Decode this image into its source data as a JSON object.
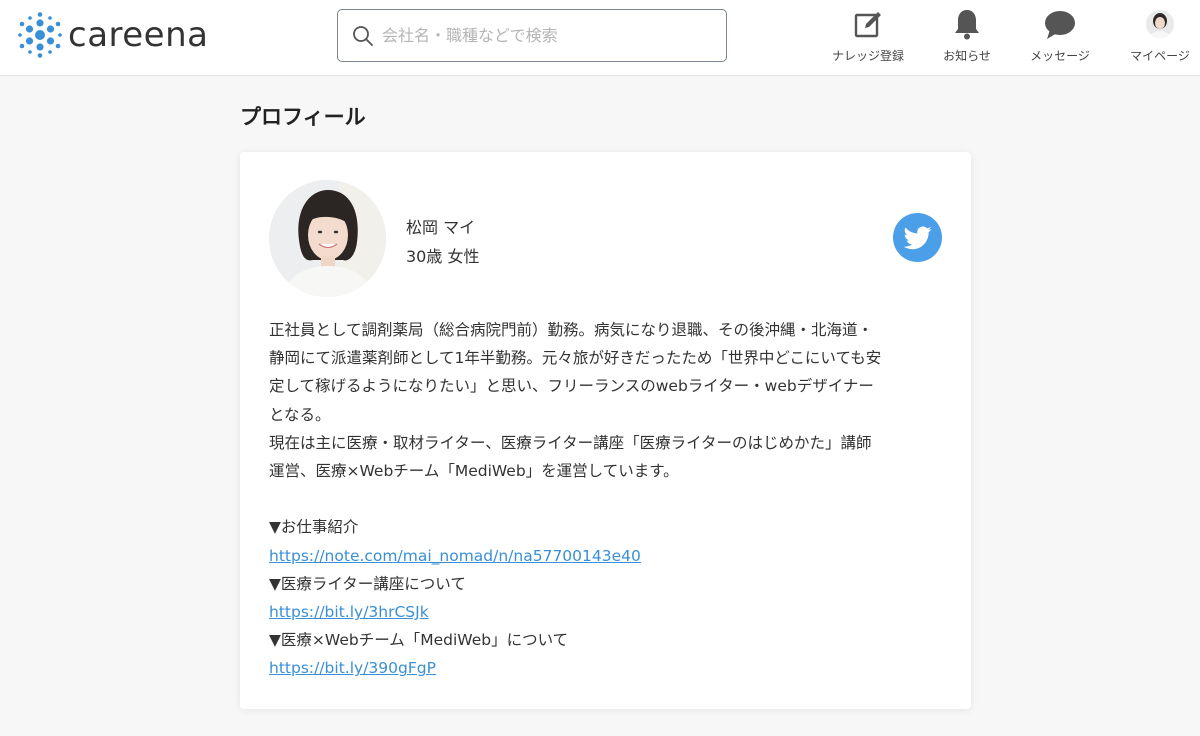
{
  "brand": {
    "name": "careena",
    "color": "#3a8fd6"
  },
  "search": {
    "placeholder": "会社名・職種などで検索",
    "value": ""
  },
  "nav": [
    {
      "label": "ナレッジ登録",
      "icon": "edit-icon"
    },
    {
      "label": "お知らせ",
      "icon": "bell-icon"
    },
    {
      "label": "メッセージ",
      "icon": "chat-bubble-icon"
    },
    {
      "label": "マイページ",
      "icon": "avatar"
    }
  ],
  "page": {
    "title": "プロフィール"
  },
  "profile": {
    "name": "松岡 マイ",
    "age_gender": "30歳 女性",
    "twitter_color": "#4a9fe8",
    "bio_lines": [
      "正社員として調剤薬局（総合病院門前）勤務。病気になり退職、その後沖縄・北海道・",
      "静岡にて派遣薬剤師として1年半勤務。元々旅が好きだったため「世界中どこにいても安",
      "定して稼げるようになりたい」と思い、フリーランスのwebライター・webデザイナー",
      "となる。",
      "現在は主に医療・取材ライター、医療ライター講座「医療ライターのはじめかた」講師",
      "運営、医療×Webチーム「MediWeb」を運営しています。"
    ],
    "links": [
      {
        "heading": "▼お仕事紹介",
        "url": "https://note.com/mai_nomad/n/na57700143e40"
      },
      {
        "heading": "▼医療ライター講座について",
        "url": "https://bit.ly/3hrCSJk"
      },
      {
        "heading": "▼医療×Webチーム「MediWeb」について",
        "url": "https://bit.ly/390gFgP"
      }
    ]
  }
}
